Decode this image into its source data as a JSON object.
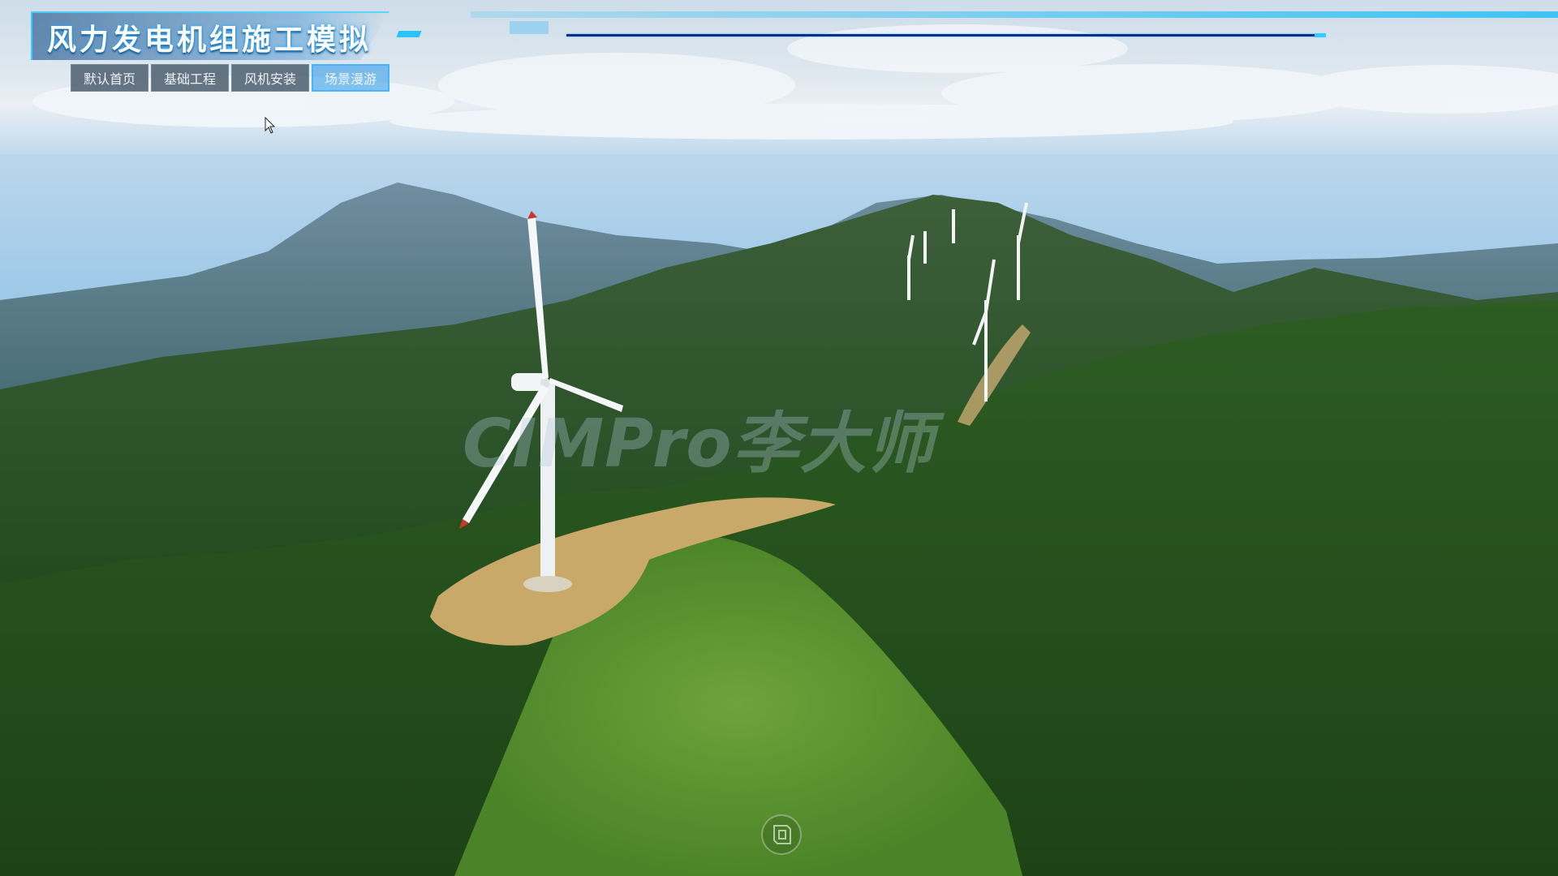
{
  "app": {
    "title": "风力发电机组施工模拟"
  },
  "nav": {
    "items": [
      {
        "label": "默认首页",
        "active": false
      },
      {
        "label": "基础工程",
        "active": false
      },
      {
        "label": "风机安装",
        "active": false
      },
      {
        "label": "场景漫游",
        "active": true
      }
    ]
  },
  "overlay": {
    "watermark": "CIMPro李大师"
  },
  "colors": {
    "accent": "#2fd0ff",
    "title_glow": "#2aa9ff",
    "nav_bg": "#46586a",
    "nav_active_border": "#44b6ff"
  },
  "icons": {
    "bottom_logo": "app-logo-icon",
    "cursor": "mouse-pointer-icon"
  }
}
